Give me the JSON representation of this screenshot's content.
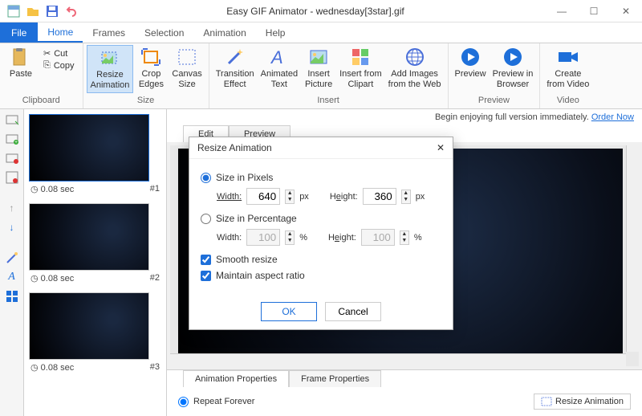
{
  "titlebar": {
    "title": "Easy GIF Animator - wednesday[3star].gif"
  },
  "menubar": {
    "file": "File",
    "tabs": [
      "Home",
      "Frames",
      "Selection",
      "Animation",
      "Help"
    ],
    "active": 0
  },
  "ribbon": {
    "clipboard": {
      "paste": "Paste",
      "cut": "Cut",
      "copy": "Copy",
      "label": "Clipboard"
    },
    "size": {
      "resize": "Resize\nAnimation",
      "crop": "Crop\nEdges",
      "canvas": "Canvas\nSize",
      "label": "Size"
    },
    "insert": {
      "transition": "Transition\nEffect",
      "atext": "Animated\nText",
      "picture": "Insert\nPicture",
      "clipart": "Insert from\nClipart",
      "web": "Add Images\nfrom the Web",
      "label": "Insert"
    },
    "preview": {
      "preview": "Preview",
      "browser": "Preview in\nBrowser",
      "label": "Preview"
    },
    "video": {
      "create": "Create\nfrom Video",
      "label": "Video"
    }
  },
  "promo": {
    "text": "Begin enjoying full version immediately.",
    "link": "Order Now"
  },
  "edit_tabs": {
    "edit": "Edit",
    "preview": "Preview"
  },
  "bottom_tabs": {
    "anim": "Animation Properties",
    "frame": "Frame Properties"
  },
  "anim_props": {
    "repeat": "Repeat Forever",
    "resize_btn": "Resize Animation"
  },
  "thumbs": [
    {
      "time": "0.08 sec",
      "idx": "#1"
    },
    {
      "time": "0.08 sec",
      "idx": "#2"
    },
    {
      "time": "0.08 sec",
      "idx": "#3"
    }
  ],
  "dialog": {
    "title": "Resize Animation",
    "opt_px": "Size in Pixels",
    "opt_pct": "Size in Percentage",
    "w": "Width:",
    "h": "Height:",
    "px": "px",
    "pct": "%",
    "val_px_w": "640",
    "val_px_h": "360",
    "val_pct_w": "100",
    "val_pct_h": "100",
    "smooth": "Smooth resize",
    "aspect": "Maintain aspect ratio",
    "ok": "OK",
    "cancel": "Cancel"
  }
}
